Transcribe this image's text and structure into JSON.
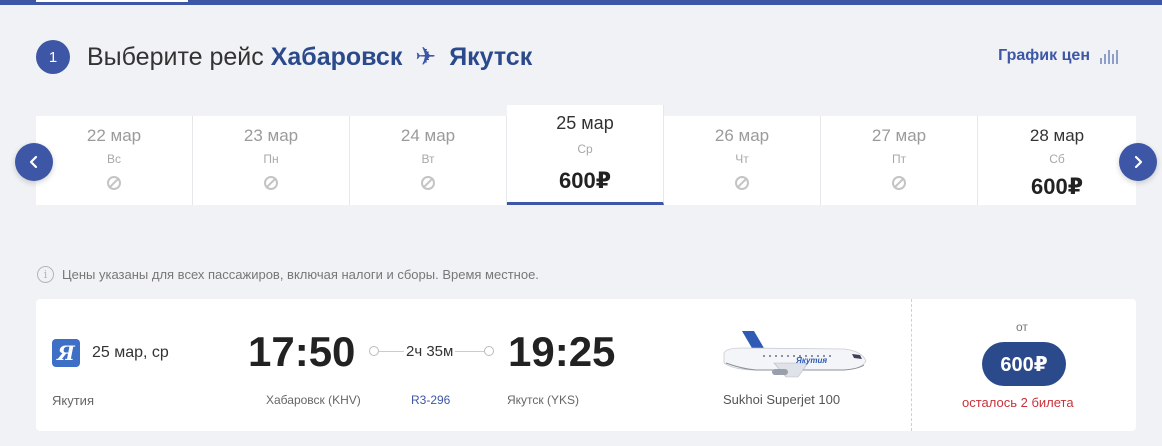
{
  "step": {
    "number": "1"
  },
  "title": {
    "prefix": "Выберите рейс",
    "origin": "Хабаровск",
    "plane_glyph": "✈",
    "destination": "Якутск"
  },
  "price_chart": {
    "label": "График цен"
  },
  "dates": [
    {
      "date": "22 мар",
      "weekday": "Вс",
      "price": null,
      "available": false
    },
    {
      "date": "23 мар",
      "weekday": "Пн",
      "price": null,
      "available": false
    },
    {
      "date": "24 мар",
      "weekday": "Вт",
      "price": null,
      "available": false
    },
    {
      "date": "25 мар",
      "weekday": "Ср",
      "price": "600₽",
      "available": true,
      "selected": true
    },
    {
      "date": "26 мар",
      "weekday": "Чт",
      "price": null,
      "available": false
    },
    {
      "date": "27 мар",
      "weekday": "Пт",
      "price": null,
      "available": false
    },
    {
      "date": "28 мар",
      "weekday": "Сб",
      "price": "600₽",
      "available": true
    }
  ],
  "note": {
    "icon": "info-icon",
    "glyph": "i",
    "text": "Цены указаны для всех пассажиров, включая налоги и сборы. Время местное."
  },
  "flight": {
    "airline_logo_letter": "Я",
    "date": "25 мар, ср",
    "airline": "Якутия",
    "departure_time": "17:50",
    "arrival_time": "19:25",
    "duration": "2ч 35м",
    "departure_airport": "Хабаровск (KHV)",
    "flight_number": "R3-296",
    "arrival_airport": "Якутск (YKS)",
    "aircraft": "Sukhoi Superjet 100",
    "from_label": "от",
    "price": "600₽",
    "seats_left": "осталось 2 билета"
  },
  "colors": {
    "accent": "#3d56a6",
    "price_button": "#2b4a8c",
    "warning": "#c8323a"
  }
}
